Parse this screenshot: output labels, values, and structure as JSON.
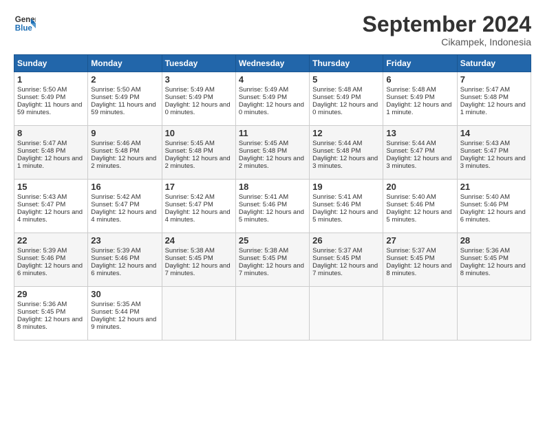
{
  "logo": {
    "line1": "General",
    "line2": "Blue"
  },
  "title": "September 2024",
  "subtitle": "Cikampek, Indonesia",
  "days_of_week": [
    "Sunday",
    "Monday",
    "Tuesday",
    "Wednesday",
    "Thursday",
    "Friday",
    "Saturday"
  ],
  "weeks": [
    [
      {
        "day": "1",
        "rise": "5:50 AM",
        "set": "5:49 PM",
        "daylight": "11 hours and 59 minutes."
      },
      {
        "day": "2",
        "rise": "5:50 AM",
        "set": "5:49 PM",
        "daylight": "11 hours and 59 minutes."
      },
      {
        "day": "3",
        "rise": "5:49 AM",
        "set": "5:49 PM",
        "daylight": "12 hours and 0 minutes."
      },
      {
        "day": "4",
        "rise": "5:49 AM",
        "set": "5:49 PM",
        "daylight": "12 hours and 0 minutes."
      },
      {
        "day": "5",
        "rise": "5:48 AM",
        "set": "5:49 PM",
        "daylight": "12 hours and 0 minutes."
      },
      {
        "day": "6",
        "rise": "5:48 AM",
        "set": "5:49 PM",
        "daylight": "12 hours and 1 minute."
      },
      {
        "day": "7",
        "rise": "5:47 AM",
        "set": "5:48 PM",
        "daylight": "12 hours and 1 minute."
      }
    ],
    [
      {
        "day": "8",
        "rise": "5:47 AM",
        "set": "5:48 PM",
        "daylight": "12 hours and 1 minute."
      },
      {
        "day": "9",
        "rise": "5:46 AM",
        "set": "5:48 PM",
        "daylight": "12 hours and 2 minutes."
      },
      {
        "day": "10",
        "rise": "5:45 AM",
        "set": "5:48 PM",
        "daylight": "12 hours and 2 minutes."
      },
      {
        "day": "11",
        "rise": "5:45 AM",
        "set": "5:48 PM",
        "daylight": "12 hours and 2 minutes."
      },
      {
        "day": "12",
        "rise": "5:44 AM",
        "set": "5:48 PM",
        "daylight": "12 hours and 3 minutes."
      },
      {
        "day": "13",
        "rise": "5:44 AM",
        "set": "5:47 PM",
        "daylight": "12 hours and 3 minutes."
      },
      {
        "day": "14",
        "rise": "5:43 AM",
        "set": "5:47 PM",
        "daylight": "12 hours and 3 minutes."
      }
    ],
    [
      {
        "day": "15",
        "rise": "5:43 AM",
        "set": "5:47 PM",
        "daylight": "12 hours and 4 minutes."
      },
      {
        "day": "16",
        "rise": "5:42 AM",
        "set": "5:47 PM",
        "daylight": "12 hours and 4 minutes."
      },
      {
        "day": "17",
        "rise": "5:42 AM",
        "set": "5:47 PM",
        "daylight": "12 hours and 4 minutes."
      },
      {
        "day": "18",
        "rise": "5:41 AM",
        "set": "5:46 PM",
        "daylight": "12 hours and 5 minutes."
      },
      {
        "day": "19",
        "rise": "5:41 AM",
        "set": "5:46 PM",
        "daylight": "12 hours and 5 minutes."
      },
      {
        "day": "20",
        "rise": "5:40 AM",
        "set": "5:46 PM",
        "daylight": "12 hours and 5 minutes."
      },
      {
        "day": "21",
        "rise": "5:40 AM",
        "set": "5:46 PM",
        "daylight": "12 hours and 6 minutes."
      }
    ],
    [
      {
        "day": "22",
        "rise": "5:39 AM",
        "set": "5:46 PM",
        "daylight": "12 hours and 6 minutes."
      },
      {
        "day": "23",
        "rise": "5:39 AM",
        "set": "5:46 PM",
        "daylight": "12 hours and 6 minutes."
      },
      {
        "day": "24",
        "rise": "5:38 AM",
        "set": "5:45 PM",
        "daylight": "12 hours and 7 minutes."
      },
      {
        "day": "25",
        "rise": "5:38 AM",
        "set": "5:45 PM",
        "daylight": "12 hours and 7 minutes."
      },
      {
        "day": "26",
        "rise": "5:37 AM",
        "set": "5:45 PM",
        "daylight": "12 hours and 7 minutes."
      },
      {
        "day": "27",
        "rise": "5:37 AM",
        "set": "5:45 PM",
        "daylight": "12 hours and 8 minutes."
      },
      {
        "day": "28",
        "rise": "5:36 AM",
        "set": "5:45 PM",
        "daylight": "12 hours and 8 minutes."
      }
    ],
    [
      {
        "day": "29",
        "rise": "5:36 AM",
        "set": "5:45 PM",
        "daylight": "12 hours and 8 minutes."
      },
      {
        "day": "30",
        "rise": "5:35 AM",
        "set": "5:44 PM",
        "daylight": "12 hours and 9 minutes."
      },
      null,
      null,
      null,
      null,
      null
    ]
  ]
}
